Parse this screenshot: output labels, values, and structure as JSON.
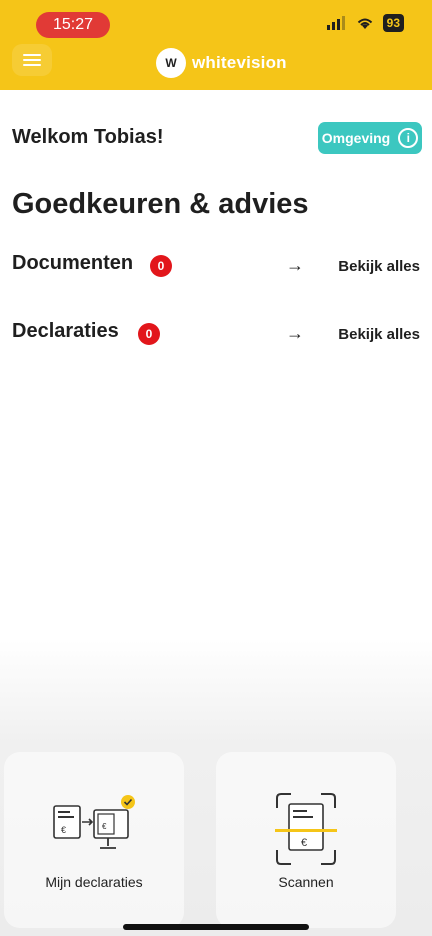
{
  "status": {
    "time": "15:27",
    "battery": "93"
  },
  "header": {
    "brand": "whitevision",
    "brand_mark": "W"
  },
  "welcome": "Welkom Tobias!",
  "environment_button": {
    "label": "Omgeving",
    "info": "i"
  },
  "section_title": "Goedkeuren & advies",
  "rows": [
    {
      "label": "Documenten",
      "count": "0",
      "arrow": "→",
      "link": "Bekijk alles"
    },
    {
      "label": "Declaraties",
      "count": "0",
      "arrow": "→",
      "link": "Bekijk alles"
    }
  ],
  "tiles": [
    {
      "label": "Mijn declaraties",
      "icon": "declarations-icon"
    },
    {
      "label": "Scannen",
      "icon": "scan-document-icon"
    }
  ],
  "colors": {
    "header": "#f5c518",
    "teal": "#3cc7c0",
    "badge": "#e2161b"
  }
}
